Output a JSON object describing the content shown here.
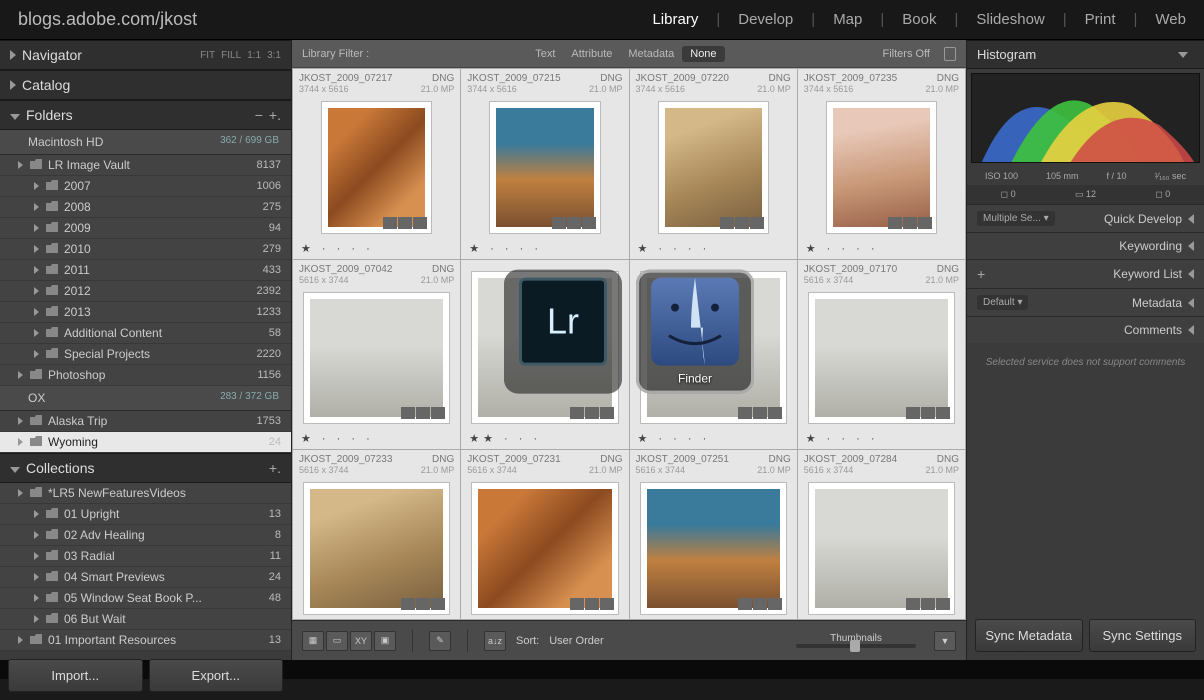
{
  "url": "blogs.adobe.com/jkost",
  "modules": [
    "Library",
    "Develop",
    "Map",
    "Book",
    "Slideshow",
    "Print",
    "Web"
  ],
  "active_module": "Library",
  "left": {
    "navigator": {
      "label": "Navigator",
      "opts": [
        "FIT",
        "FILL",
        "1:1",
        "3:1"
      ]
    },
    "catalog": {
      "label": "Catalog"
    },
    "folders": {
      "label": "Folders"
    },
    "drives": [
      {
        "name": "Macintosh HD",
        "stat": "362 / 699 GB"
      },
      {
        "name": "OX",
        "stat": "283 / 372 GB"
      }
    ],
    "tree1": [
      {
        "label": "LR Image Vault",
        "cnt": "8137",
        "lvl": 1
      },
      {
        "label": "2007",
        "cnt": "1006",
        "lvl": 2
      },
      {
        "label": "2008",
        "cnt": "275",
        "lvl": 2
      },
      {
        "label": "2009",
        "cnt": "94",
        "lvl": 2
      },
      {
        "label": "2010",
        "cnt": "279",
        "lvl": 2
      },
      {
        "label": "2011",
        "cnt": "433",
        "lvl": 2
      },
      {
        "label": "2012",
        "cnt": "2392",
        "lvl": 2
      },
      {
        "label": "2013",
        "cnt": "1233",
        "lvl": 2
      },
      {
        "label": "Additional Content",
        "cnt": "58",
        "lvl": 2
      },
      {
        "label": "Special Projects",
        "cnt": "2220",
        "lvl": 2
      },
      {
        "label": "Photoshop",
        "cnt": "1156",
        "lvl": 1
      }
    ],
    "tree2": [
      {
        "label": "Alaska Trip",
        "cnt": "1753",
        "lvl": 1
      },
      {
        "label": "Wyoming",
        "cnt": "24",
        "lvl": 1,
        "selected": true
      }
    ],
    "collections": {
      "label": "Collections"
    },
    "col_tree": [
      {
        "label": "*LR5 NewFeaturesVideos",
        "cnt": "",
        "lvl": 1
      },
      {
        "label": "01 Upright",
        "cnt": "13",
        "lvl": 2
      },
      {
        "label": "02 Adv Healing",
        "cnt": "8",
        "lvl": 2
      },
      {
        "label": "03 Radial",
        "cnt": "11",
        "lvl": 2
      },
      {
        "label": "04 Smart Previews",
        "cnt": "24",
        "lvl": 2
      },
      {
        "label": "05 Window Seat Book P...",
        "cnt": "48",
        "lvl": 2
      },
      {
        "label": "06 But Wait",
        "cnt": "",
        "lvl": 2
      },
      {
        "label": "01 Important Resources",
        "cnt": "13",
        "lvl": 1
      }
    ],
    "import": "Import...",
    "export": "Export..."
  },
  "filter": {
    "label": "Library Filter :",
    "items": [
      "Text",
      "Attribute",
      "Metadata",
      "None"
    ],
    "active": "None",
    "right": "Filters Off"
  },
  "grid": [
    {
      "name": "JKOST_2009_07217",
      "fmt": "DNG",
      "dim": "3744 x 5616",
      "mp": "21.0 MP",
      "cls": "t-orange",
      "stars": "★ · · · ·"
    },
    {
      "name": "JKOST_2009_07215",
      "fmt": "DNG",
      "dim": "3744 x 5616",
      "mp": "21.0 MP",
      "cls": "t-multi",
      "stars": "★ · · · ·"
    },
    {
      "name": "JKOST_2009_07220",
      "fmt": "DNG",
      "dim": "3744 x 5616",
      "mp": "21.0 MP",
      "cls": "t-tan",
      "stars": "★ · · · ·"
    },
    {
      "name": "JKOST_2009_07235",
      "fmt": "DNG",
      "dim": "3744 x 5616",
      "mp": "21.0 MP",
      "cls": "t-pink",
      "stars": "★ · · · ·"
    },
    {
      "name": "JKOST_2009_07042",
      "fmt": "DNG",
      "dim": "5616 x 3744",
      "mp": "21.0 MP",
      "cls": "t-cloud",
      "stars": "★ · · · ·"
    },
    {
      "name": "",
      "fmt": "",
      "dim": "",
      "mp": "",
      "cls": "t-cloud",
      "stars": "★★ · · ·"
    },
    {
      "name": "",
      "fmt": "",
      "dim": "",
      "mp": "",
      "cls": "t-cloud",
      "stars": "★ · · · ·"
    },
    {
      "name": "JKOST_2009_07170",
      "fmt": "DNG",
      "dim": "5616 x 3744",
      "mp": "21.0 MP",
      "cls": "t-cloud",
      "stars": "★ · · · ·"
    },
    {
      "name": "JKOST_2009_07233",
      "fmt": "DNG",
      "dim": "5616 x 3744",
      "mp": "21.0 MP",
      "cls": "t-tan",
      "stars": ""
    },
    {
      "name": "JKOST_2009_07231",
      "fmt": "DNG",
      "dim": "5616 x 3744",
      "mp": "21.0 MP",
      "cls": "t-orange",
      "stars": ""
    },
    {
      "name": "JKOST_2009_07251",
      "fmt": "DNG",
      "dim": "5616 x 3744",
      "mp": "21.0 MP",
      "cls": "t-multi",
      "stars": ""
    },
    {
      "name": "JKOST_2009_07284",
      "fmt": "DNG",
      "dim": "5616 x 3744",
      "mp": "21.0 MP",
      "cls": "t-cloud",
      "stars": ""
    }
  ],
  "toolbar": {
    "sort_label": "Sort:",
    "sort_value": "User Order",
    "slider_label": "Thumbnails"
  },
  "right": {
    "histogram": "Histogram",
    "meta": [
      "ISO 100",
      "105 mm",
      "f / 10",
      "¹⁄₁₆₀ sec"
    ],
    "crop_meta": [
      "0",
      "12",
      "0"
    ],
    "panels": [
      {
        "label": "Quick Develop",
        "dd": "Multiple Se..."
      },
      {
        "label": "Keywording",
        "dd": ""
      },
      {
        "label": "Keyword List",
        "dd": "",
        "plus": true
      },
      {
        "label": "Metadata",
        "dd": "Default"
      },
      {
        "label": "Comments",
        "dd": ""
      }
    ],
    "comments_msg": "Selected service does not support comments",
    "sync_meta": "Sync Metadata",
    "sync_set": "Sync Settings"
  },
  "switcher": {
    "apps": [
      {
        "name": "Lr",
        "label": ""
      },
      {
        "name": "Finder",
        "label": "Finder"
      }
    ],
    "selected": 1
  }
}
